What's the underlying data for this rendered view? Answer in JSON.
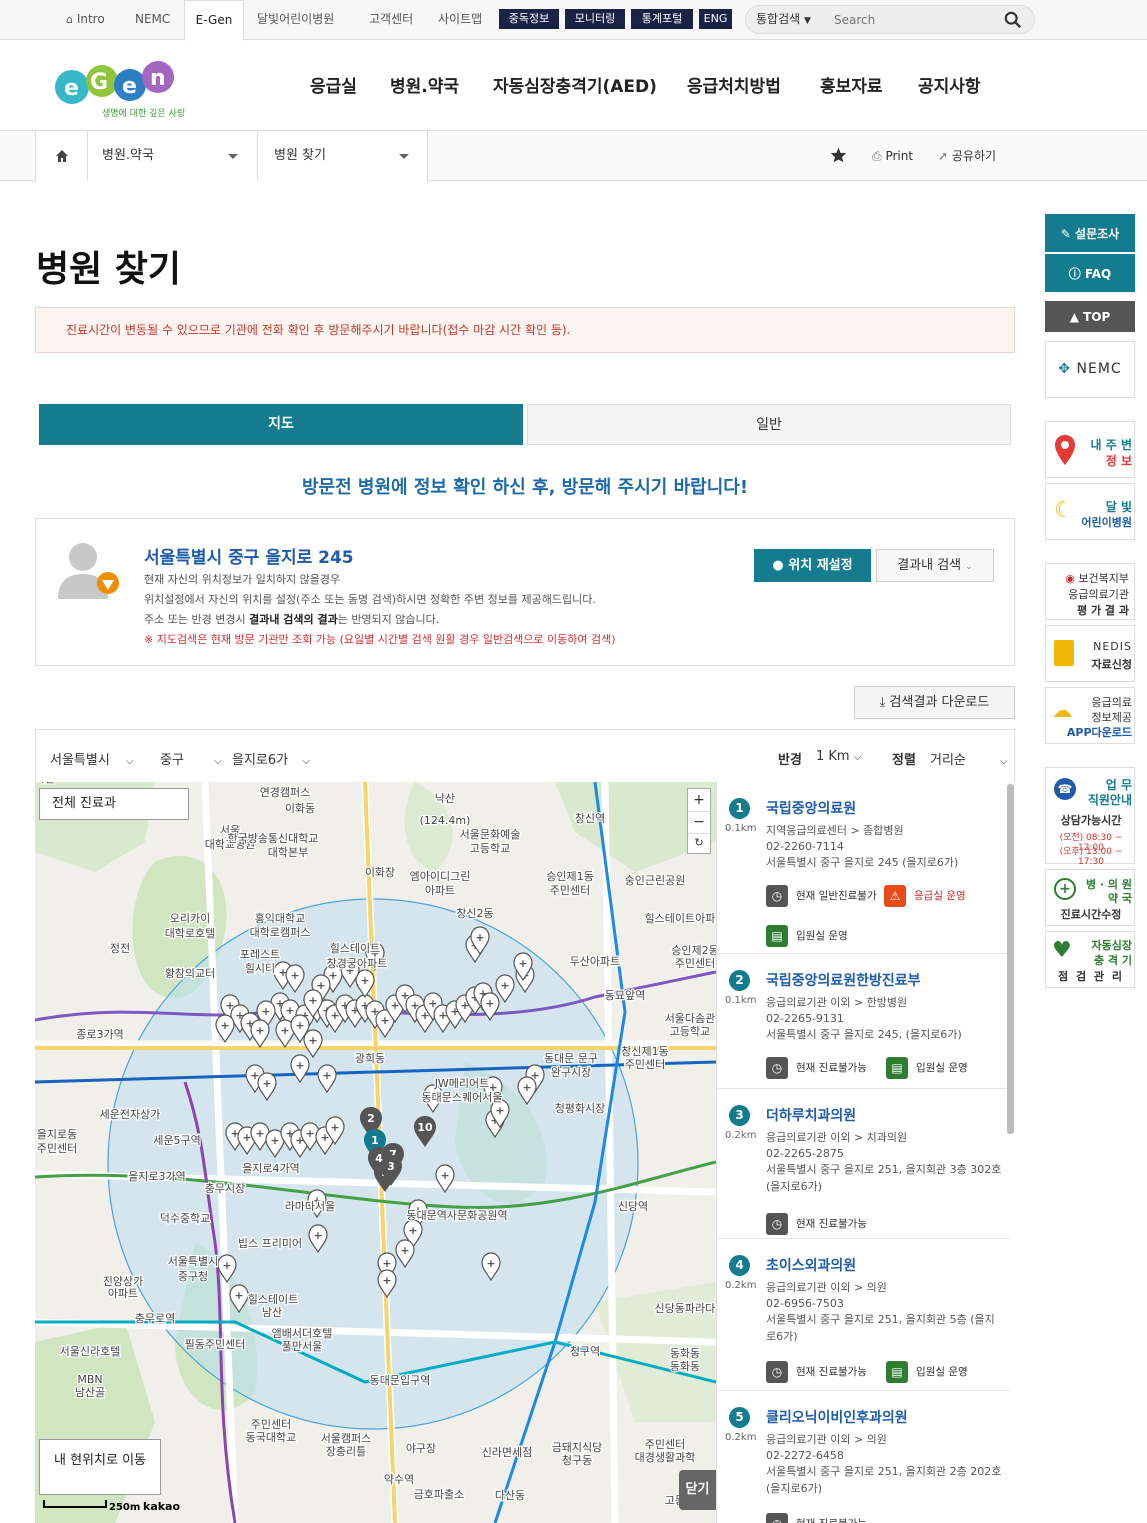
{
  "util": {
    "intro": "Intro",
    "nemc": "NEMC",
    "egen": "E-Gen",
    "kids": "달빛어린이병원",
    "center": "고객센터",
    "sitemap": "사이트맵",
    "btn1": "중독정보",
    "btn2": "모니터링",
    "btn3": "통계포털",
    "btn4": "ENG",
    "search_scope": "통합검색",
    "search_placeholder": "Search"
  },
  "logo": {
    "text": "E-Gen",
    "tagline": "생명에 대한 깊은 사랑"
  },
  "gnb": [
    "응급실",
    "병원.약국",
    "자동심장충격기(AED)",
    "응급처치방법",
    "홍보자료",
    "공지사항"
  ],
  "breadcrumb": {
    "level1": "병원.약국",
    "level2": "병원 찾기",
    "print": "Print",
    "share": "공유하기"
  },
  "quick": {
    "survey": "설문조사",
    "faq": "FAQ",
    "top": "TOP",
    "nemc": "NEMC",
    "near_l1": "내 주 변",
    "near_l2": "정 보",
    "moon_l1": "달 빛",
    "moon_l2": "어린이병원",
    "mohw_l1": "보건복지부",
    "mohw_l2": "응급의료기관",
    "mohw_l3": "평 가 결 과",
    "nedis_l1": "NEDIS",
    "nedis_l2": "자료신청",
    "app_l1": "응급의료",
    "app_l2": "정보제공",
    "app_l3": "APP다운로드",
    "call_l1": "업 무",
    "call_l2": "직원안내",
    "call_l3": "상담가능시간",
    "call_l4": "(오전) 08:30 ~ 12:00",
    "call_l5": "(오후) 13:00 ~ 17:30",
    "hosp_l1": "병 · 의 원",
    "hosp_l2": "약 국",
    "hosp_l3": "진료시간수정",
    "aed_l1": "자동심장",
    "aed_l2": "충 격 기",
    "aed_l3": "점 검 관 리"
  },
  "page": {
    "title": "병원 찾기",
    "notice": "진료시간이 변동될 수 있으므로 기관에 전화 확인 후 방문해주시기 바랍니다(접수 마감 시간 확인 등).",
    "tab_map": "지도",
    "tab_general": "일반",
    "subtitle": "방문전 병원에 정보 확인 하신 후, 방문해 주시기 바랍니다!"
  },
  "location": {
    "address": "서울특별시 중구 을지로 245",
    "l1": "현재 자신의 위치정보가 일치하지 않을경우",
    "l2": "위치설정에서 자신의 위치를 설정(주소 또는 동명 검색)하시면 정확한 주변 정보를 제공해드립니다.",
    "l3a": "주소 또는 반경 변경시 ",
    "l3b": "결과내 검색의 결과",
    "l3c": "는 반영되지 않습니다.",
    "l4": "※ 지도검색은 현재 방문 기관만 조회 가능 (요일별 시간별 검색 원활 경우 일반검색으로 이동하여 검색)",
    "reset_btn": "위치 재설정",
    "search_btn": "결과내 검색"
  },
  "download": "검색결과 다운로드",
  "filter": {
    "sido": "서울특별시",
    "gugun": "중구",
    "dong": "을지로6가",
    "radius_label": "반경",
    "radius": "1 Km",
    "sort_label": "정렬",
    "sort": "거리순"
  },
  "map": {
    "dept_btn": "전체 진료과",
    "myloc_btn": "내 현위치로 이동",
    "close_btn": "닫기",
    "scale": "250m",
    "brand": "kakao",
    "labels": [
      "연경캠퍼스",
      "이화동",
      "낙산",
      "(124.4m)",
      "창신역",
      "서울문화예술",
      "고등학교",
      "창경궁",
      "서울",
      "대학교병원",
      "한국방송통신대학교",
      "대학본부",
      "이화장",
      "엠아이디그린",
      "아파트",
      "승인제1동",
      "주민센터",
      "창신2동",
      "숭인근린공원",
      "힐스테이트아파트",
      "오리카이",
      "대학로호텔",
      "홍익대학교",
      "대학로캠퍼스",
      "정전",
      "황참의교터",
      "포레스트",
      "힐시티",
      "힐스테이트",
      "창경궁아파트",
      "두산아파트",
      "승인제2동",
      "주민센터",
      "동묘앞역",
      "종로3가역",
      "서울다솜관",
      "고등학교",
      "창신제1동",
      "주민센터",
      "광희동",
      "동대문 문구",
      "완구시장",
      "JW메리어트",
      "동대문스퀘어서울",
      "청평화시장",
      "세운전자상가",
      "을지로동",
      "주민센터",
      "세운5구역",
      "을지로3가역",
      "을지로4가역",
      "동대문역사문화공원역",
      "신당역",
      "충무시장",
      "덕수중학교",
      "라마다서울",
      "빕스 프리미어",
      "서울특별시",
      "중구청",
      "진양상가",
      "아파트",
      "힐스테이트",
      "남산",
      "충무로역",
      "필동주민센터",
      "앰배서더호텔",
      "풀만서울",
      "동대문입구역",
      "청구역",
      "신당동파라다이스",
      "동화동",
      "동화동",
      "주민센터",
      "동국대학교",
      "서울캠퍼스",
      "장충리틀",
      "야구장",
      "신라면세점",
      "금돼지식당",
      "청구동",
      "주민센터",
      "대경생활과학",
      "고등학교",
      "금호파출소",
      "다산동",
      "약수역",
      "서울신라호텔",
      "MBN",
      "남산골",
      "한옥마을"
    ]
  },
  "results": [
    {
      "no": "1",
      "dist": "0.1km",
      "name": "국립중앙의료원",
      "type": "지역응급의료센터 > 종합병원",
      "tel": "02-2260-7114",
      "addr": "서울특별시 중구 을지로 245 (을지로6가)",
      "s1": "현재 일반진료불가",
      "s2": "응급실 운영",
      "s3": "입원실 운영"
    },
    {
      "no": "2",
      "dist": "0.1km",
      "name": "국립중앙의료원한방진료부",
      "type": "응급의료기관 이외 > 한방병원",
      "tel": "02-2265-9131",
      "addr": "서울특별시 중구 을지로 245, (을지로6가)",
      "s1": "현재 진료불가능",
      "s2": "입원실 운영"
    },
    {
      "no": "3",
      "dist": "0.2km",
      "name": "더하루치과의원",
      "type": "응급의료기관 이외 > 치과의원",
      "tel": "02-2265-2875",
      "addr": "서울특별시 중구 을지로 251, 을지회관 3층 302호 (을지로6가)",
      "s1": "현재 진료불가능"
    },
    {
      "no": "4",
      "dist": "0.2km",
      "name": "초이스외과의원",
      "type": "응급의료기관 이외 > 의원",
      "tel": "02-6956-7503",
      "addr": "서울특별시 중구 을지로 251, 을지회관 5층 (을지로6가)",
      "s1": "현재 진료불가능",
      "s2": "입원실 운영"
    },
    {
      "no": "5",
      "dist": "0.2km",
      "name": "클리오닉이비인후과의원",
      "type": "응급의료기관 이외 > 의원",
      "tel": "02-2272-6458",
      "addr": "서울특별시 중구 을지로 251, 을지회관 2층 202호 (을지로6가)",
      "s1": "현재 진료불가능"
    }
  ],
  "colors": {
    "teal": "#147c8e",
    "navy": "#1a2346",
    "orange": "#f08c00",
    "red": "#d32f2f",
    "link": "#1e5ba8"
  }
}
